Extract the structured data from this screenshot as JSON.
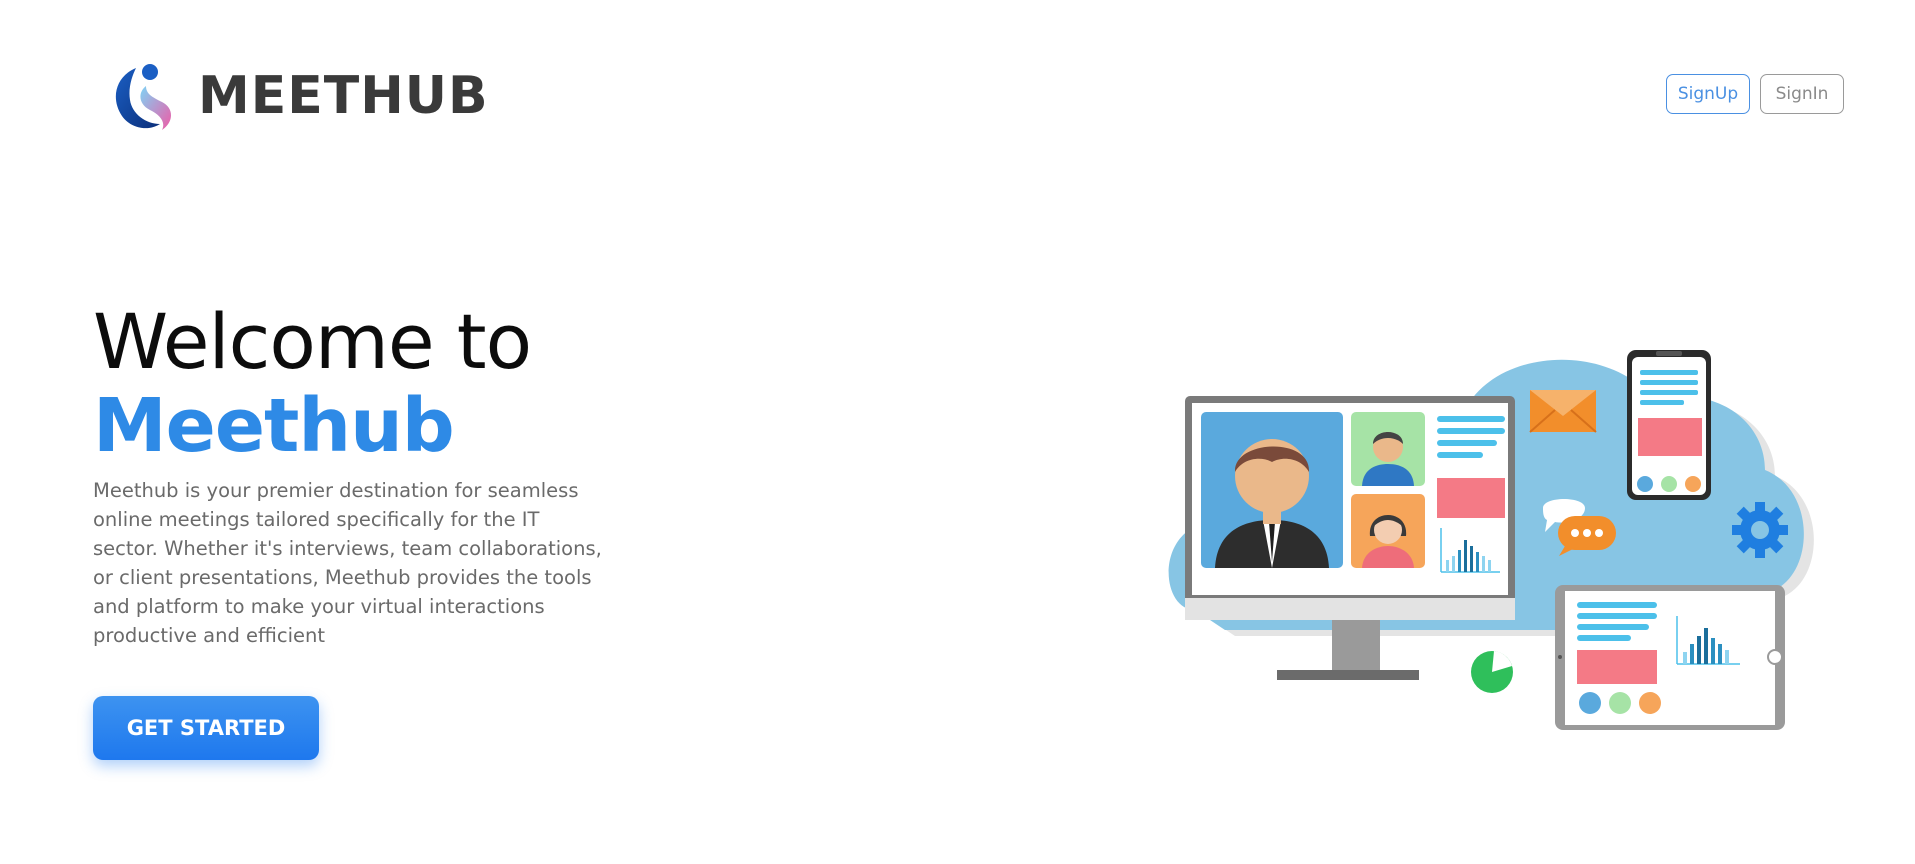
{
  "brand": {
    "name": "MEETHUB"
  },
  "header": {
    "signup_label": "SignUp",
    "signin_label": "SignIn"
  },
  "hero": {
    "title_line1": "Welcome to",
    "title_line2": "Meethub",
    "description": "Meethub is your premier destination for seamless online meetings tailored specifically for the IT sector. Whether it's interviews, team collaborations, or client presentations, Meethub provides the tools and platform to make your virtual interactions productive and efficient",
    "cta_label": "GET STARTED"
  },
  "colors": {
    "accent": "#2e8ae6",
    "cta": "#1e78ee",
    "cloud": "#87c5e4",
    "tile_pink": "#f47a86",
    "tile_blue": "#4cc0ea"
  }
}
